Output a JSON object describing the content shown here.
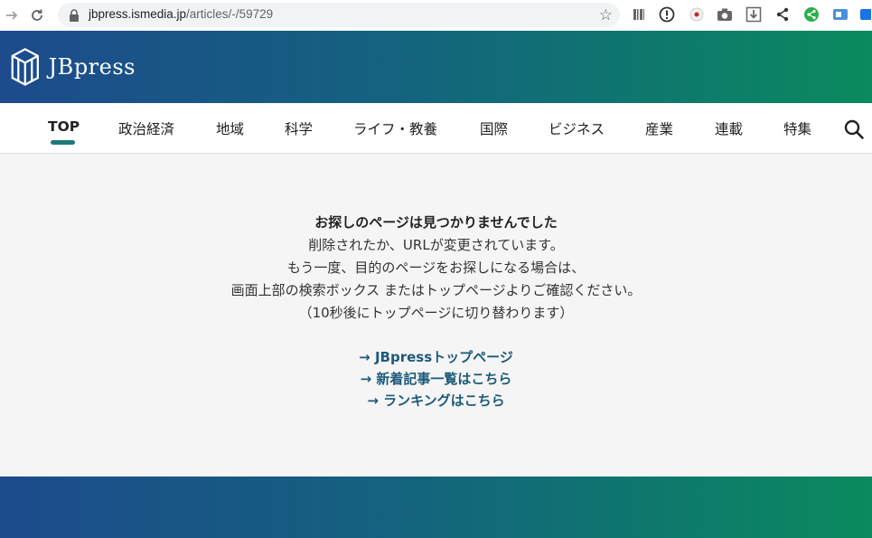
{
  "browser": {
    "url_host": "jbpress.ismedia.jp",
    "url_path": "/articles/-/59729"
  },
  "header": {
    "logo_text": "JBpress"
  },
  "nav": {
    "items": [
      {
        "label": "TOP",
        "active": true
      },
      {
        "label": "政治経済"
      },
      {
        "label": "地域"
      },
      {
        "label": "科学"
      },
      {
        "label": "ライフ・教養"
      },
      {
        "label": "国際"
      },
      {
        "label": "ビジネス"
      },
      {
        "label": "産業"
      },
      {
        "label": "連載"
      },
      {
        "label": "特集"
      }
    ]
  },
  "error": {
    "title": "お探しのページは見つかりませんでした",
    "line1": "削除されたか、URLが変更されています。",
    "line2": "もう一度、目的のページをお探しになる場合は、",
    "line3": "画面上部の検索ボックス またはトップページよりご確認ください。",
    "line4": "（10秒後にトップページに切り替わります）"
  },
  "links": {
    "top": "→ JBpressトップページ",
    "new_articles": "→ 新着記事一覧はこちら",
    "ranking": "→ ランキングはこちら"
  },
  "colors": {
    "brand_start": "#1d4b8c",
    "brand_end": "#0a8a5e",
    "active_underline": "#1a7a7a",
    "link": "#1d5a7a"
  }
}
